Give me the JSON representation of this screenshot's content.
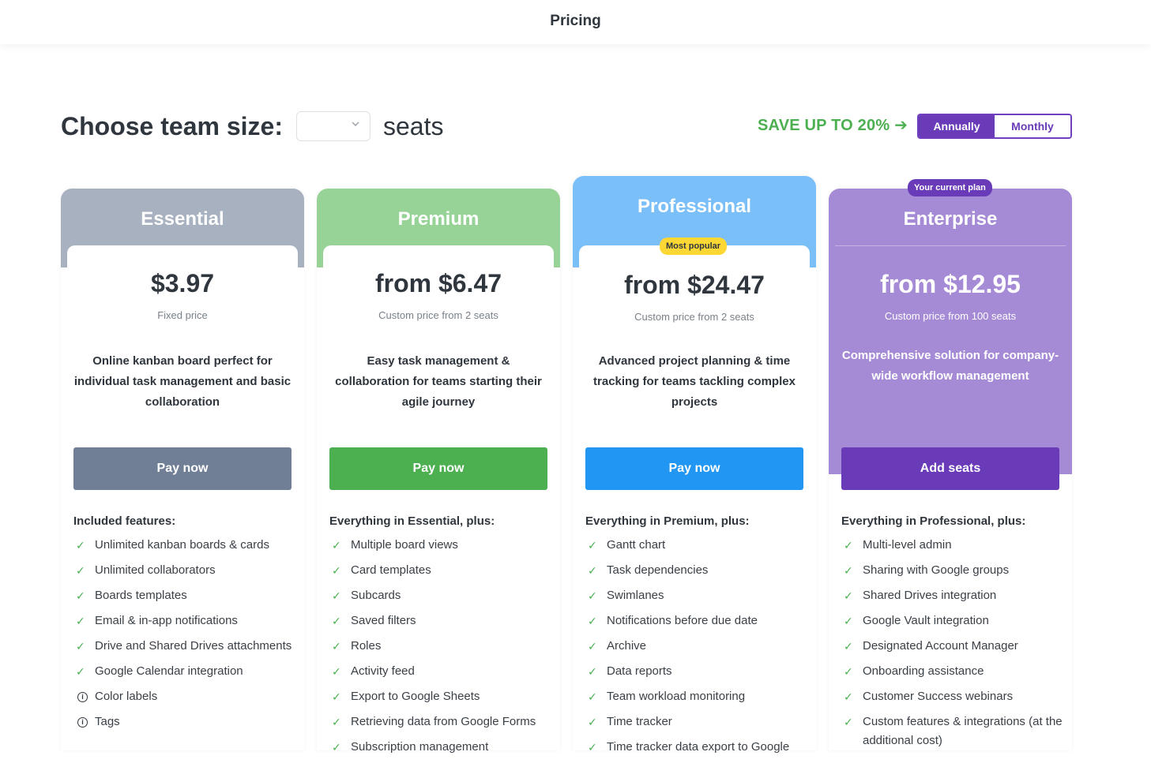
{
  "header": {
    "title": "Pricing"
  },
  "team": {
    "label": "Choose team size:",
    "seats_word": "seats",
    "seat_value": ""
  },
  "billing": {
    "save_text": "SAVE UP TO 20% ➔",
    "annually": "Annually",
    "monthly": "Monthly",
    "selected": "Annually"
  },
  "plans": [
    {
      "name": "Essential",
      "price": "$3.97",
      "sub": "Fixed price",
      "desc": "Online kanban board perfect for individual task management and basic collaboration",
      "button": "Pay now",
      "color": "#a7b1c0",
      "button_color": "#717f96",
      "features_title": "Included features:",
      "features": [
        {
          "text": "Unlimited kanban boards & cards",
          "icon": "check-icon"
        },
        {
          "text": "Unlimited collaborators",
          "icon": "check-icon"
        },
        {
          "text": "Boards templates",
          "icon": "check-icon"
        },
        {
          "text": "Email & in-app notifications",
          "icon": "check-icon"
        },
        {
          "text": "Drive and Shared Drives attachments",
          "icon": "check-icon"
        },
        {
          "text": "Google Calendar integration",
          "icon": "check-icon"
        },
        {
          "text": "Color labels",
          "icon": "info-icon"
        },
        {
          "text": "Tags",
          "icon": "info-icon"
        }
      ]
    },
    {
      "name": "Premium",
      "price": "from $6.47",
      "sub": "Custom price from 2 seats",
      "desc": "Easy task management & collaboration for teams starting their agile journey",
      "button": "Pay now",
      "color": "#97d396",
      "button_color": "#4caf50",
      "features_title": "Everything in Essential, plus:",
      "features": [
        {
          "text": "Multiple board views",
          "icon": "check-icon"
        },
        {
          "text": "Card templates",
          "icon": "check-icon"
        },
        {
          "text": "Subcards",
          "icon": "check-icon"
        },
        {
          "text": "Saved filters",
          "icon": "check-icon"
        },
        {
          "text": "Roles",
          "icon": "check-icon"
        },
        {
          "text": "Activity feed",
          "icon": "check-icon"
        },
        {
          "text": "Export to Google Sheets",
          "icon": "check-icon"
        },
        {
          "text": "Retrieving data from Google Forms",
          "icon": "check-icon"
        },
        {
          "text": "Subscription management",
          "icon": "check-icon"
        }
      ]
    },
    {
      "name": "Professional",
      "price": "from $24.47",
      "sub": "Custom price from 2 seats",
      "desc": "Advanced project planning & time tracking for teams tackling complex projects",
      "button": "Pay now",
      "color": "#7bbff8",
      "button_color": "#2196f3",
      "badge": "Most popular",
      "features_title": "Everything in Premium, plus:",
      "features": [
        {
          "text": "Gantt chart",
          "icon": "check-icon"
        },
        {
          "text": "Task dependencies",
          "icon": "check-icon"
        },
        {
          "text": "Swimlanes",
          "icon": "check-icon"
        },
        {
          "text": "Notifications before due date",
          "icon": "check-icon"
        },
        {
          "text": "Archive",
          "icon": "check-icon"
        },
        {
          "text": "Data reports",
          "icon": "check-icon"
        },
        {
          "text": "Team workload monitoring",
          "icon": "check-icon"
        },
        {
          "text": "Time tracker",
          "icon": "check-icon"
        },
        {
          "text": "Time tracker data export to Google",
          "icon": "check-icon"
        }
      ]
    },
    {
      "name": "Enterprise",
      "price": "from $12.95",
      "sub": "Custom price from 100 seats",
      "desc": "Comprehensive solution for company-wide workflow management",
      "button": "Add seats",
      "color": "#a58ad6",
      "button_color": "#6a3bb8",
      "badge": "Your current plan",
      "features_title": "Everything in Professional, plus:",
      "features": [
        {
          "text": "Multi-level admin",
          "icon": "check-icon"
        },
        {
          "text": "Sharing with Google groups",
          "icon": "check-icon"
        },
        {
          "text": "Shared Drives integration",
          "icon": "check-icon"
        },
        {
          "text": "Google Vault integration",
          "icon": "check-icon"
        },
        {
          "text": "Designated Account Manager",
          "icon": "check-icon"
        },
        {
          "text": "Onboarding assistance",
          "icon": "check-icon"
        },
        {
          "text": "Customer Success webinars",
          "icon": "check-icon"
        },
        {
          "text": "Custom features & integrations (at the additional cost)",
          "icon": "check-icon"
        }
      ]
    }
  ],
  "colors": {
    "accent_purple": "#6a3bb8",
    "save_green": "#4caf50",
    "popular_badge": "#fdd835"
  }
}
